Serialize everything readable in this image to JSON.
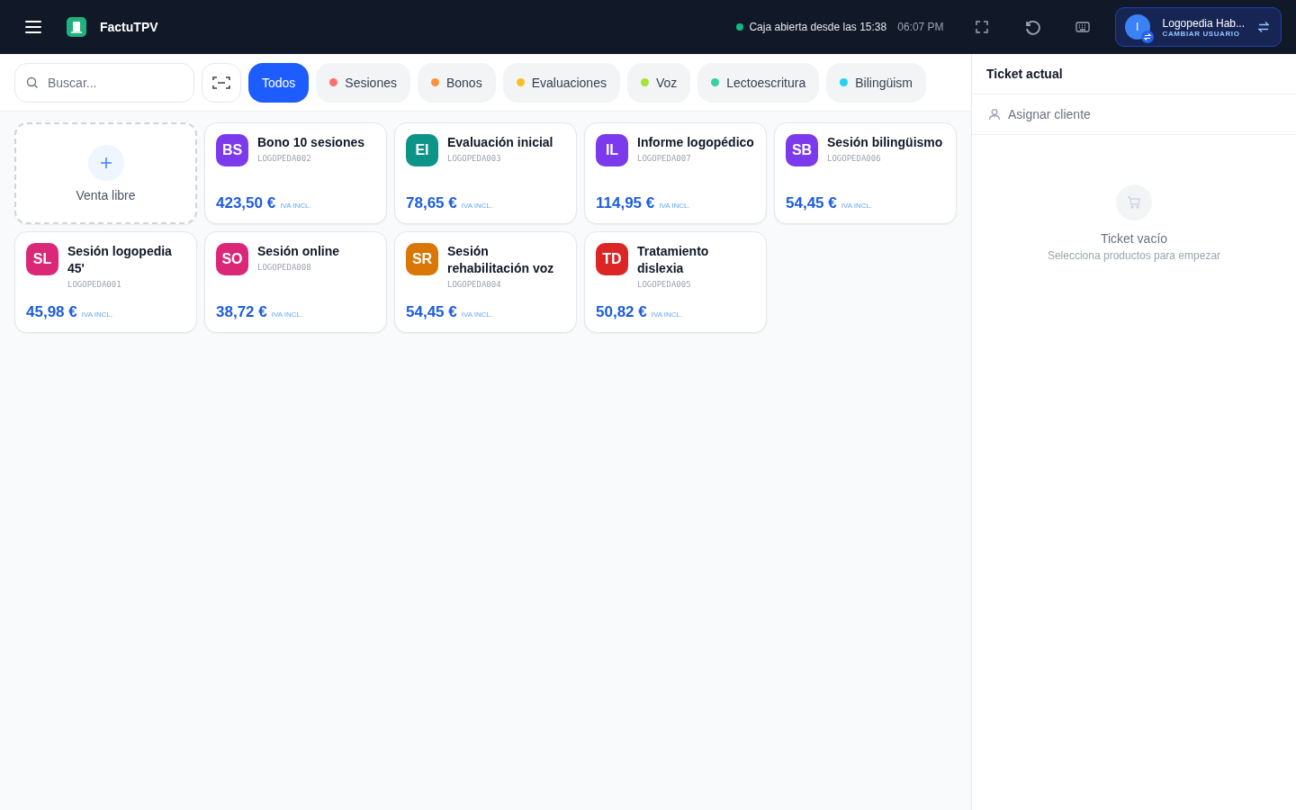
{
  "header": {
    "app_name": "FactuTPV",
    "status": "Caja abierta desde las 15:38",
    "time": "06:07 PM",
    "user": {
      "initial": "I",
      "name": "Logopedia Hab...",
      "action": "CAMBIAR USUARIO"
    }
  },
  "search": {
    "placeholder": "Buscar..."
  },
  "categories": [
    {
      "label": "Todos",
      "selected": true
    },
    {
      "label": "Sesiones",
      "selected": false,
      "color": "#f87171"
    },
    {
      "label": "Bonos",
      "selected": false,
      "color": "#fb923c"
    },
    {
      "label": "Evaluaciones",
      "selected": false,
      "color": "#fbbf24"
    },
    {
      "label": "Voz",
      "selected": false,
      "color": "#a3e635"
    },
    {
      "label": "Lectoescritura",
      "selected": false,
      "color": "#34d399"
    },
    {
      "label": "Bilingüism",
      "selected": false,
      "color": "#22d3ee"
    }
  ],
  "free_sale": {
    "label": "Venta libre"
  },
  "products": [
    {
      "initials": "BS",
      "color": "#7c3aed",
      "name": "Bono 10 sesiones",
      "code": "LOGOPEDA002",
      "price": "423,50 €",
      "tax": "IVA INCL."
    },
    {
      "initials": "EI",
      "color": "#0d9488",
      "name": "Evaluación inicial",
      "code": "LOGOPEDA003",
      "price": "78,65 €",
      "tax": "IVA INCL."
    },
    {
      "initials": "IL",
      "color": "#7c3aed",
      "name": "Informe logopédico",
      "code": "LOGOPEDA007",
      "price": "114,95 €",
      "tax": "IVA INCL."
    },
    {
      "initials": "SB",
      "color": "#7c3aed",
      "name": "Sesión bilingüismo",
      "code": "LOGOPEDA006",
      "price": "54,45 €",
      "tax": "IVA INCL."
    },
    {
      "initials": "SL",
      "color": "#db2777",
      "name": "Sesión logopedia 45'",
      "code": "LOGOPEDA001",
      "price": "45,98 €",
      "tax": "IVA INCL."
    },
    {
      "initials": "SO",
      "color": "#db2777",
      "name": "Sesión online",
      "code": "LOGOPEDA008",
      "price": "38,72 €",
      "tax": "IVA INCL."
    },
    {
      "initials": "SR",
      "color": "#d97706",
      "name": "Sesión rehabilitación voz",
      "code": "LOGOPEDA004",
      "price": "54,45 €",
      "tax": "IVA INCL."
    },
    {
      "initials": "TD",
      "color": "#dc2626",
      "name": "Tratamiento dislexia",
      "code": "LOGOPEDA005",
      "price": "50,82 €",
      "tax": "IVA INCL."
    }
  ],
  "ticket": {
    "title": "Ticket actual",
    "assign": "Asignar cliente",
    "empty_title": "Ticket vacío",
    "empty_hint": "Selecciona productos para empezar"
  }
}
